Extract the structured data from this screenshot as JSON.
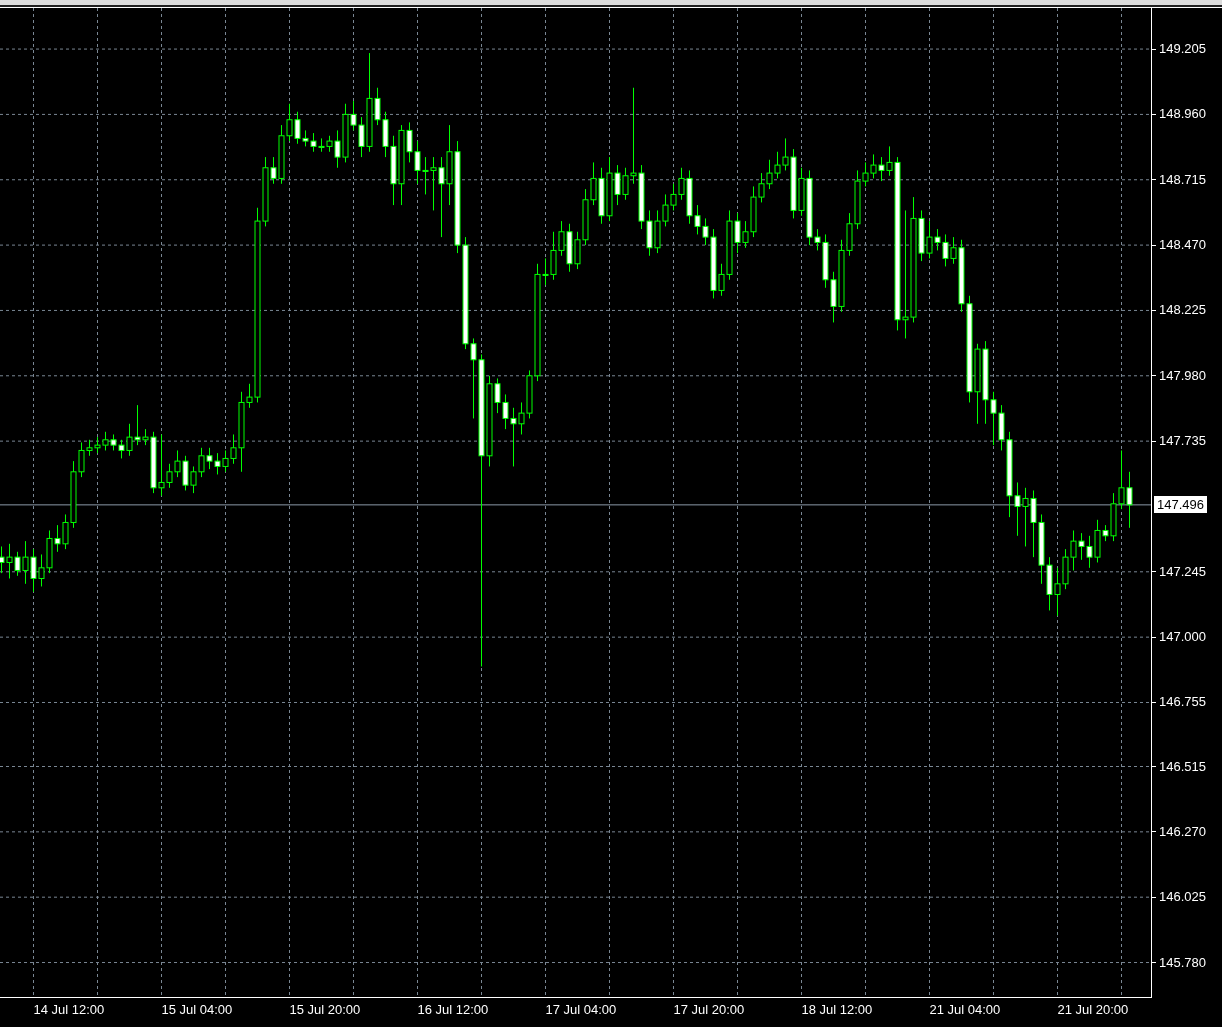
{
  "chart_data": {
    "type": "candlestick",
    "ylim": [
      145.647,
      149.359
    ],
    "grid": true,
    "yticks": [
      {
        "value": 149.205,
        "label": "149.205"
      },
      {
        "value": 148.96,
        "label": "148.960"
      },
      {
        "value": 148.715,
        "label": "148.715"
      },
      {
        "value": 148.47,
        "label": "148.470"
      },
      {
        "value": 148.225,
        "label": "148.225"
      },
      {
        "value": 147.98,
        "label": "147.980"
      },
      {
        "value": 147.735,
        "label": "147.735"
      },
      {
        "value": 147.245,
        "label": "147.245"
      },
      {
        "value": 147.0,
        "label": "147.000"
      },
      {
        "value": 146.755,
        "label": "146.755"
      },
      {
        "value": 146.515,
        "label": "146.515"
      },
      {
        "value": 146.27,
        "label": "146.270"
      },
      {
        "value": 146.025,
        "label": "146.025"
      },
      {
        "value": 145.78,
        "label": "145.780"
      }
    ],
    "ref_lines": [
      {
        "axis": "y",
        "value": 147.496,
        "label": "147.496"
      }
    ],
    "ohlc": [
      [
        147.3,
        147.34,
        147.24,
        147.28
      ],
      [
        147.28,
        147.35,
        147.22,
        147.3
      ],
      [
        147.3,
        147.32,
        147.23,
        147.25
      ],
      [
        147.25,
        147.36,
        147.2,
        147.3
      ],
      [
        147.3,
        147.33,
        147.17,
        147.22
      ],
      [
        147.22,
        147.31,
        147.19,
        147.26
      ],
      [
        147.26,
        147.4,
        147.24,
        147.37
      ],
      [
        147.37,
        147.42,
        147.32,
        147.35
      ],
      [
        147.35,
        147.46,
        147.33,
        147.43
      ],
      [
        147.43,
        147.66,
        147.41,
        147.62
      ],
      [
        147.62,
        147.73,
        147.6,
        147.7
      ],
      [
        147.7,
        147.74,
        147.68,
        147.71
      ],
      [
        147.71,
        147.75,
        147.69,
        147.72
      ],
      [
        147.72,
        147.77,
        147.7,
        147.74
      ],
      [
        147.74,
        147.76,
        147.7,
        147.72
      ],
      [
        147.72,
        147.74,
        147.67,
        147.7
      ],
      [
        147.7,
        147.8,
        147.68,
        147.75
      ],
      [
        147.75,
        147.87,
        147.72,
        147.74
      ],
      [
        147.74,
        147.78,
        147.72,
        147.75
      ],
      [
        147.75,
        147.77,
        147.54,
        147.56
      ],
      [
        147.56,
        147.76,
        147.53,
        147.58
      ],
      [
        147.58,
        147.65,
        147.56,
        147.62
      ],
      [
        147.62,
        147.7,
        147.6,
        147.66
      ],
      [
        147.66,
        147.68,
        147.55,
        147.57
      ],
      [
        147.57,
        147.64,
        147.54,
        147.62
      ],
      [
        147.62,
        147.71,
        147.6,
        147.68
      ],
      [
        147.68,
        147.71,
        147.63,
        147.66
      ],
      [
        147.66,
        147.69,
        147.61,
        147.64
      ],
      [
        147.64,
        147.7,
        147.62,
        147.67
      ],
      [
        147.67,
        147.76,
        147.65,
        147.71
      ],
      [
        147.71,
        147.92,
        147.62,
        147.88
      ],
      [
        147.88,
        147.95,
        147.86,
        147.9
      ],
      [
        147.9,
        148.61,
        147.88,
        148.56
      ],
      [
        148.56,
        148.8,
        148.54,
        148.76
      ],
      [
        148.76,
        148.8,
        148.7,
        148.72
      ],
      [
        148.72,
        148.92,
        148.7,
        148.88
      ],
      [
        148.88,
        149.0,
        148.86,
        148.94
      ],
      [
        148.94,
        148.97,
        148.85,
        148.87
      ],
      [
        148.87,
        148.9,
        148.84,
        148.86
      ],
      [
        148.86,
        148.89,
        148.82,
        148.84
      ],
      [
        148.84,
        148.87,
        148.82,
        148.84
      ],
      [
        148.84,
        148.88,
        148.82,
        148.86
      ],
      [
        148.86,
        148.9,
        148.76,
        148.8
      ],
      [
        148.8,
        149.0,
        148.78,
        148.96
      ],
      [
        148.96,
        149.01,
        148.9,
        148.92
      ],
      [
        148.92,
        148.95,
        148.8,
        148.84
      ],
      [
        148.84,
        149.19,
        148.82,
        149.02
      ],
      [
        149.02,
        149.06,
        148.92,
        148.94
      ],
      [
        148.94,
        148.97,
        148.8,
        148.84
      ],
      [
        148.84,
        148.88,
        148.62,
        148.7
      ],
      [
        148.7,
        148.92,
        148.62,
        148.9
      ],
      [
        148.9,
        148.93,
        148.78,
        148.82
      ],
      [
        148.82,
        148.86,
        148.7,
        148.75
      ],
      [
        148.75,
        148.8,
        148.66,
        148.75
      ],
      [
        148.75,
        148.8,
        148.6,
        148.76
      ],
      [
        148.76,
        148.8,
        148.5,
        148.7
      ],
      [
        148.7,
        148.92,
        148.62,
        148.82
      ],
      [
        148.82,
        148.86,
        148.44,
        148.47
      ],
      [
        148.47,
        148.5,
        148.08,
        148.1
      ],
      [
        148.1,
        148.12,
        147.82,
        148.04
      ],
      [
        148.04,
        148.06,
        146.89,
        147.68
      ],
      [
        147.68,
        147.98,
        147.64,
        147.95
      ],
      [
        147.95,
        147.97,
        147.84,
        147.88
      ],
      [
        147.88,
        147.91,
        147.78,
        147.82
      ],
      [
        147.82,
        147.86,
        147.64,
        147.8
      ],
      [
        147.8,
        147.88,
        147.76,
        147.84
      ],
      [
        147.84,
        148.0,
        147.82,
        147.98
      ],
      [
        147.98,
        148.4,
        147.96,
        148.36
      ],
      [
        148.36,
        148.42,
        148.32,
        148.36
      ],
      [
        148.36,
        148.52,
        148.34,
        148.45
      ],
      [
        148.45,
        148.56,
        148.43,
        148.52
      ],
      [
        148.52,
        148.55,
        148.37,
        148.4
      ],
      [
        148.4,
        148.52,
        148.38,
        148.49
      ],
      [
        148.49,
        148.68,
        148.47,
        148.64
      ],
      [
        148.64,
        148.78,
        148.62,
        148.72
      ],
      [
        148.72,
        148.76,
        148.55,
        148.58
      ],
      [
        148.58,
        148.8,
        148.56,
        148.74
      ],
      [
        148.74,
        148.77,
        148.62,
        148.66
      ],
      [
        148.66,
        148.76,
        148.64,
        148.73
      ],
      [
        148.73,
        149.06,
        148.7,
        148.74
      ],
      [
        148.74,
        148.77,
        148.53,
        148.56
      ],
      [
        148.56,
        148.6,
        148.43,
        148.46
      ],
      [
        148.46,
        148.6,
        148.44,
        148.56
      ],
      [
        148.56,
        148.66,
        148.54,
        148.62
      ],
      [
        148.62,
        148.7,
        148.6,
        148.66
      ],
      [
        148.66,
        148.76,
        148.64,
        148.72
      ],
      [
        148.72,
        148.75,
        148.55,
        148.58
      ],
      [
        148.58,
        148.62,
        148.51,
        148.54
      ],
      [
        148.54,
        148.57,
        148.47,
        148.5
      ],
      [
        148.5,
        148.53,
        148.27,
        148.3
      ],
      [
        148.3,
        148.4,
        148.28,
        148.36
      ],
      [
        148.36,
        148.6,
        148.34,
        148.56
      ],
      [
        148.56,
        148.59,
        148.44,
        148.48
      ],
      [
        148.48,
        148.56,
        148.46,
        148.52
      ],
      [
        148.52,
        148.69,
        148.5,
        148.65
      ],
      [
        148.65,
        148.74,
        148.63,
        148.7
      ],
      [
        148.7,
        148.79,
        148.68,
        148.74
      ],
      [
        148.74,
        148.82,
        148.72,
        148.77
      ],
      [
        148.77,
        148.87,
        148.75,
        148.8
      ],
      [
        148.8,
        148.83,
        148.57,
        148.6
      ],
      [
        148.6,
        148.76,
        148.58,
        148.72
      ],
      [
        148.72,
        148.75,
        148.47,
        148.5
      ],
      [
        148.5,
        148.53,
        148.45,
        148.48
      ],
      [
        148.48,
        148.51,
        148.31,
        148.34
      ],
      [
        148.34,
        148.37,
        148.18,
        148.24
      ],
      [
        148.24,
        148.49,
        148.22,
        148.45
      ],
      [
        148.45,
        148.59,
        148.43,
        148.55
      ],
      [
        148.55,
        148.75,
        148.53,
        148.71
      ],
      [
        148.71,
        148.78,
        148.69,
        148.74
      ],
      [
        148.74,
        148.81,
        148.72,
        148.77
      ],
      [
        148.77,
        148.8,
        148.71,
        148.75
      ],
      [
        148.75,
        148.84,
        148.73,
        148.78
      ],
      [
        148.78,
        148.8,
        148.15,
        148.19
      ],
      [
        148.19,
        148.6,
        148.12,
        148.2
      ],
      [
        148.2,
        148.65,
        148.18,
        148.57
      ],
      [
        148.57,
        148.6,
        148.41,
        148.44
      ],
      [
        148.44,
        148.56,
        148.42,
        148.5
      ],
      [
        148.5,
        148.53,
        148.45,
        148.48
      ],
      [
        148.48,
        148.51,
        148.39,
        148.42
      ],
      [
        148.42,
        148.5,
        148.4,
        148.46
      ],
      [
        148.46,
        148.49,
        148.22,
        148.25
      ],
      [
        148.25,
        148.28,
        147.88,
        147.92
      ],
      [
        147.92,
        148.1,
        147.8,
        148.08
      ],
      [
        148.08,
        148.11,
        147.8,
        147.89
      ],
      [
        147.89,
        147.92,
        147.72,
        147.84
      ],
      [
        147.84,
        147.87,
        147.7,
        147.74
      ],
      [
        147.74,
        147.77,
        147.45,
        147.53
      ],
      [
        147.53,
        147.58,
        147.38,
        147.49
      ],
      [
        147.49,
        147.56,
        147.34,
        147.52
      ],
      [
        147.52,
        147.55,
        147.3,
        147.43
      ],
      [
        147.43,
        147.46,
        147.2,
        147.27
      ],
      [
        147.27,
        147.3,
        147.1,
        147.16
      ],
      [
        147.16,
        147.26,
        147.08,
        147.2
      ],
      [
        147.2,
        147.33,
        147.18,
        147.3
      ],
      [
        147.3,
        147.4,
        147.25,
        147.36
      ],
      [
        147.36,
        147.39,
        147.29,
        147.34
      ],
      [
        147.34,
        147.38,
        147.26,
        147.3
      ],
      [
        147.3,
        147.44,
        147.28,
        147.4
      ],
      [
        147.4,
        147.42,
        147.36,
        147.38
      ],
      [
        147.38,
        147.54,
        147.36,
        147.5
      ],
      [
        147.5,
        147.7,
        147.48,
        147.56
      ],
      [
        147.56,
        147.62,
        147.41,
        147.496
      ]
    ]
  },
  "time_axis": {
    "labels": [
      "14 Jul 12:00",
      "15 Jul 04:00",
      "15 Jul 20:00",
      "16 Jul 12:00",
      "17 Jul 04:00",
      "17 Jul 20:00",
      "18 Jul 12:00",
      "21 Jul 04:00",
      "21 Jul 20:00"
    ]
  }
}
